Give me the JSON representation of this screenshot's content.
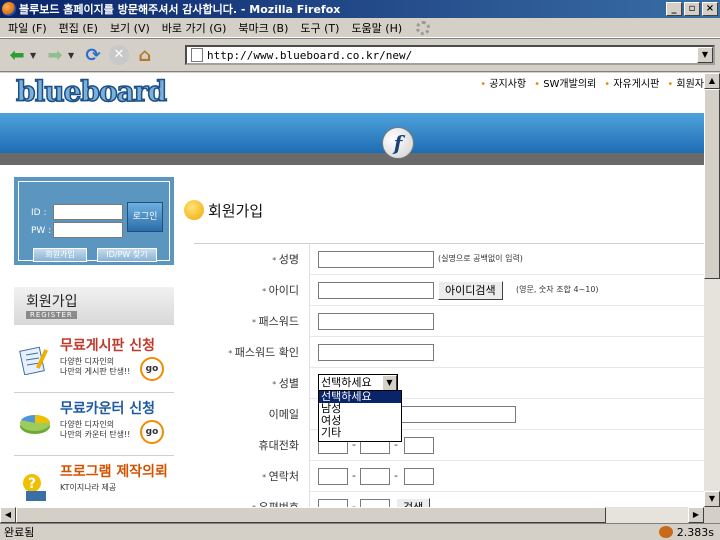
{
  "window": {
    "title": "블루보드 홈페이지를 방문해주셔서 감사합니다. - Mozilla Firefox"
  },
  "menu": [
    "파일 (F)",
    "편집 (E)",
    "보기 (V)",
    "바로 가기 (G)",
    "북마크 (B)",
    "도구 (T)",
    "도움말 (H)"
  ],
  "address": {
    "url": "http://www.blueboard.co.kr/new/"
  },
  "site": {
    "logo": "blueboard",
    "topnav": [
      "공지사항",
      "SW개발의뢰",
      "자유게시판",
      "회원자"
    ]
  },
  "login": {
    "id_label": "ID :",
    "pw_label": "PW :",
    "login_button": "로그인",
    "join_button": "회원가입",
    "find_button": "ID/PW 찾기"
  },
  "sidebar": {
    "register_title": "회원가입",
    "register_sub": "REGISTER",
    "promos": [
      {
        "title": "무료게시판 신청",
        "desc1": "다양한 디자인의",
        "desc2": "나만의 게시판 탄생!!",
        "go": "go"
      },
      {
        "title": "무료카운터 신청",
        "desc1": "다양한 디자인의",
        "desc2": "나만의 카운터 탄생!!",
        "go": "go"
      },
      {
        "title": "프로그램 제작의뢰",
        "desc1": "KT이지나라 제공",
        "desc2": "",
        "go": ""
      }
    ]
  },
  "form": {
    "title": "회원가입",
    "name_label": "성명",
    "name_hint": "(실명으로 공백없이 입력)",
    "id_label": "아이디",
    "id_check": "아이디검색",
    "id_hint": "(영문, 숫자 조합 4~10)",
    "pw_label": "패스워드",
    "pw_confirm_label": "패스워드 확인",
    "gender_label": "성별",
    "gender_selected": "선택하세요",
    "gender_options": [
      "선택하세요",
      "남성",
      "여성",
      "기타"
    ],
    "email_label": "이메일",
    "mobile_label": "휴대전화",
    "contact_label": "연락처",
    "zip_label": "우편번호",
    "zip_search": "검색",
    "dash": "-"
  },
  "status": {
    "text": "완료됨",
    "time": "2.383s"
  }
}
